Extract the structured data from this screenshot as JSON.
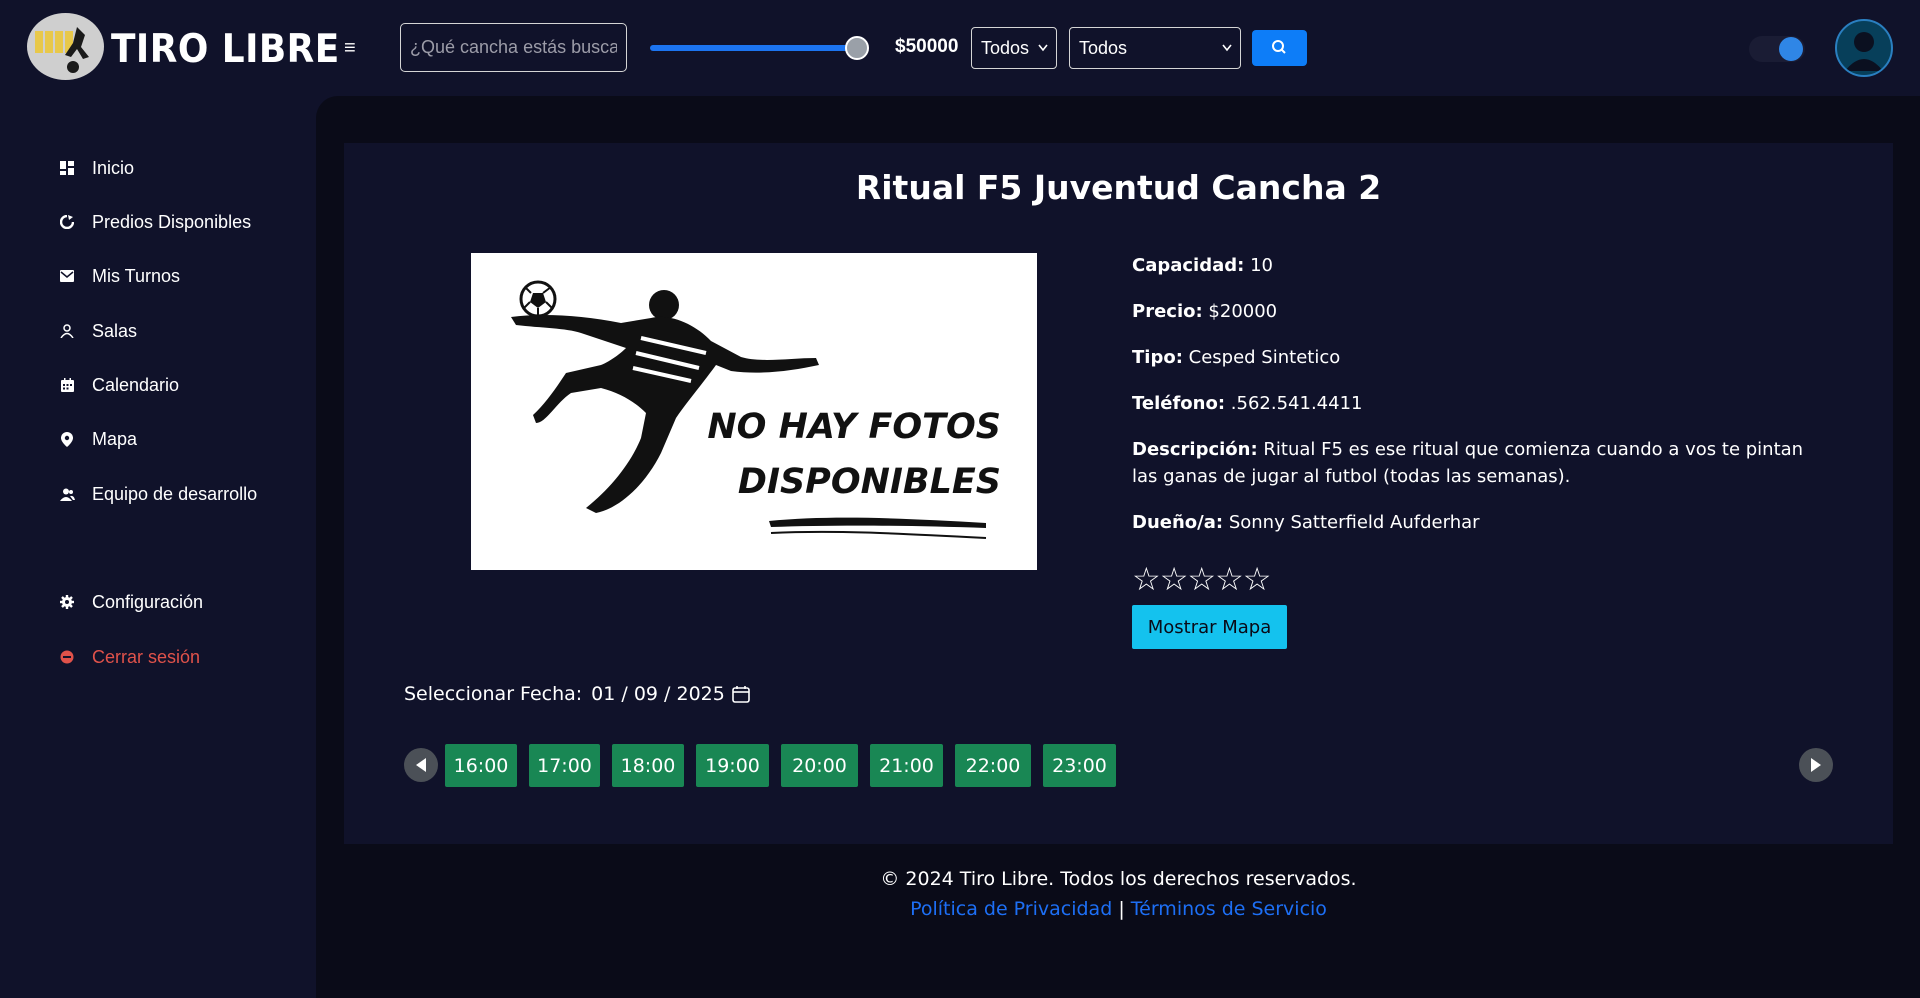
{
  "header": {
    "brand": "TIRO LIBRE",
    "menu_icon": "hamburger-icon",
    "search_placeholder": "¿Qué cancha estás buscando?",
    "price_value": "$50000",
    "price_slider_fraction": 1.0,
    "filter1_value": "Todos",
    "filter2_value": "Todos",
    "search_button_icon": "search-icon",
    "theme_toggle_on": true,
    "avatar_icon": "user-icon",
    "accent_color": "#0d7df8"
  },
  "sidebar": {
    "items": [
      {
        "label": "Inicio",
        "icon": "dashboard-icon"
      },
      {
        "label": "Predios Disponibles",
        "icon": "refresh-icon"
      },
      {
        "label": "Mis Turnos",
        "icon": "envelope-icon"
      },
      {
        "label": "Salas",
        "icon": "person-icon"
      },
      {
        "label": "Calendario",
        "icon": "calendar-icon"
      },
      {
        "label": "Mapa",
        "icon": "map-pin-icon"
      },
      {
        "label": "Equipo de desarrollo",
        "icon": "team-icon"
      }
    ],
    "settings_label": "Configuración",
    "logout_label": "Cerrar sesión",
    "logout_color": "#e0524a"
  },
  "main": {
    "title": "Ritual F5 Juventud Cancha 2",
    "photo_text_line1": "NO HAY FOTOS",
    "photo_text_line2": "DISPONIBLES",
    "capacidad_label": "Capacidad:",
    "capacidad_value": "10",
    "precio_label": "Precio:",
    "precio_value": "$20000",
    "tipo_label": "Tipo:",
    "tipo_value": "Cesped Sintetico",
    "telefono_label": "Teléfono:",
    "telefono_value": ".562.541.4411",
    "descripcion_label": "Descripción:",
    "descripcion_value": "Ritual F5 es ese ritual que comienza cuando a vos te pintan las ganas de jugar al futbol (todas las semanas).",
    "dueno_label": "Dueño/a:",
    "dueno_value": "Sonny Satterfield Aufderhar",
    "rating_filled": 0,
    "rating_max": 5,
    "stars_text": "☆☆☆☆☆",
    "map_button_label": "Mostrar Mapa",
    "date_label": "Seleccionar Fecha:",
    "date_value": "01 / 09 / 2025",
    "time_slots": [
      "16:00",
      "17:00",
      "18:00",
      "19:00",
      "20:00",
      "21:00",
      "22:00",
      "23:00"
    ],
    "slot_color": "#198754"
  },
  "footer": {
    "copyright": "© 2024 Tiro Libre. Todos los derechos reservados.",
    "privacy_link": "Política de Privacidad",
    "separator": "|",
    "terms_link": "Términos de Servicio"
  }
}
